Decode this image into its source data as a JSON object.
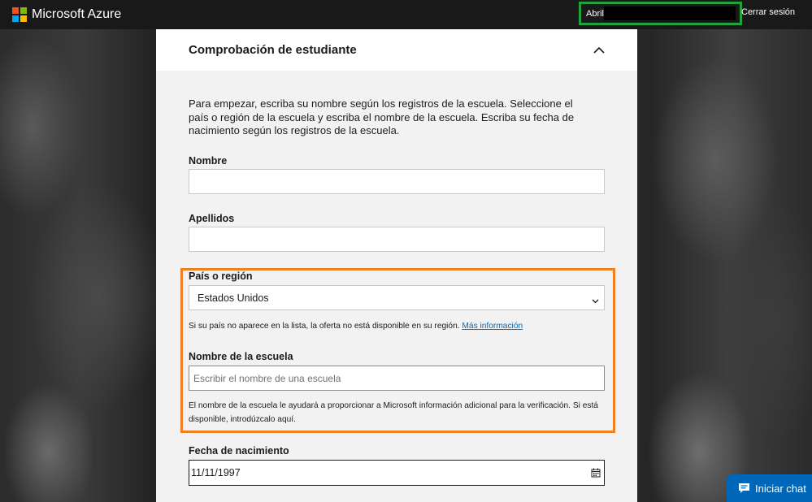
{
  "header": {
    "brand": "Microsoft Azure",
    "user_name": "Abril",
    "signout_label": "Cerrar sesión"
  },
  "panel": {
    "title": "Comprobación de estudiante",
    "intro": "Para empezar, escriba su nombre según los registros de la escuela. Seleccione el país o región de la escuela y escriba el nombre de la escuela. Escriba su fecha de nacimiento según los registros de la escuela.",
    "first_name_label": "Nombre",
    "first_name_value": "",
    "last_name_label": "Apellidos",
    "last_name_value": "",
    "country_label": "País o región",
    "country_value": "Estados Unidos",
    "country_help": "Si su país no aparece en la lista, la oferta no está disponible en su región.",
    "country_help_link": "Más información",
    "school_label": "Nombre de la escuela",
    "school_placeholder": "Escribir el nombre de una escuela",
    "school_help": "El nombre de la escuela le ayudará a proporcionar a Microsoft información adicional para la verificación. Si está disponible, introdúzcalo aquí.",
    "dob_label": "Fecha de nacimiento",
    "dob_value": "11/11/1997"
  },
  "chat": {
    "label": "Iniciar chat"
  },
  "colors": {
    "topbar": "#191919",
    "user_highlight": "#1fa33a",
    "section_highlight": "#f07f21",
    "accent": "#0067b8"
  }
}
